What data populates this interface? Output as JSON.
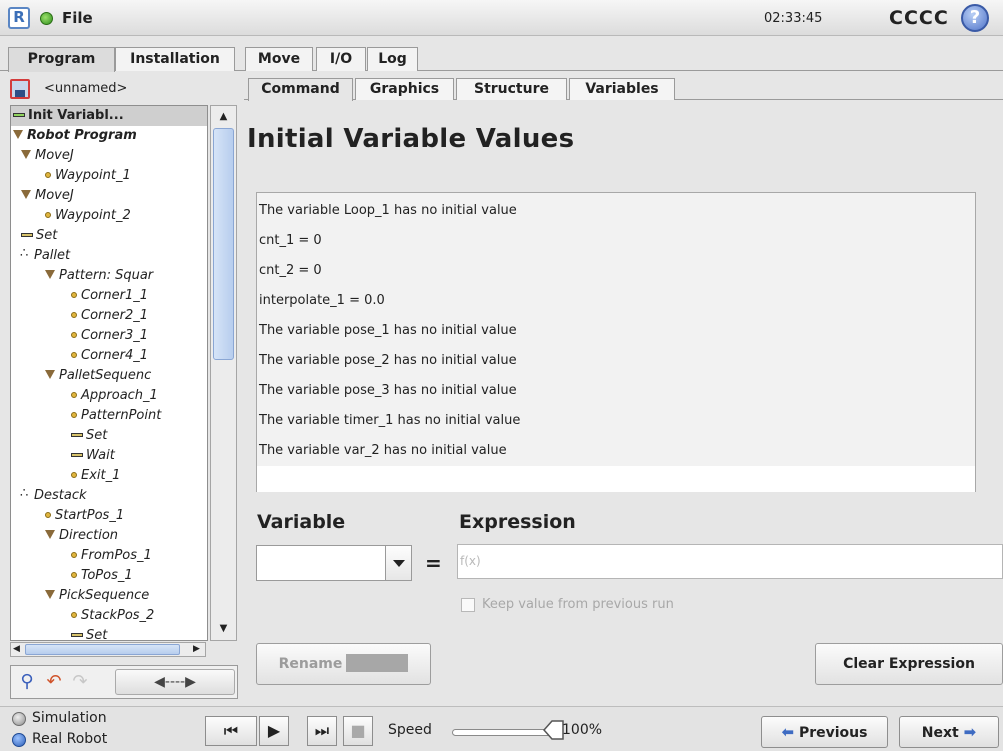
{
  "topbar": {
    "logo": "R",
    "file_label": "File",
    "clock": "02:33:45",
    "robot_name": "CCCC",
    "help": "?"
  },
  "main_tabs": [
    "Program",
    "Installation",
    "Move",
    "I/O",
    "Log"
  ],
  "program": {
    "name": "<unnamed>"
  },
  "tree": [
    {
      "label": "Init Variabl...",
      "level": 0,
      "icon": "bar-green",
      "bold": true,
      "selected": true,
      "italic": false
    },
    {
      "label": "Robot Program",
      "level": 0,
      "icon": "triangle",
      "bold": true,
      "italic": true
    },
    {
      "label": "MoveJ",
      "level": 1,
      "icon": "triangle",
      "italic": true
    },
    {
      "label": "Waypoint_1",
      "level": 2,
      "icon": "waypoint",
      "italic": true
    },
    {
      "label": "MoveJ",
      "level": 1,
      "icon": "triangle",
      "italic": true
    },
    {
      "label": "Waypoint_2",
      "level": 2,
      "icon": "waypoint",
      "italic": true
    },
    {
      "label": "Set",
      "level": 1,
      "icon": "bar",
      "italic": true
    },
    {
      "label": "Pallet",
      "level": 1,
      "icon": "pallet",
      "italic": true
    },
    {
      "label": "Pattern: Squar",
      "level": 2,
      "icon": "triangle",
      "italic": true
    },
    {
      "label": "Corner1_1",
      "level": 3,
      "icon": "waypoint",
      "italic": true
    },
    {
      "label": "Corner2_1",
      "level": 3,
      "icon": "waypoint",
      "italic": true
    },
    {
      "label": "Corner3_1",
      "level": 3,
      "icon": "waypoint",
      "italic": true
    },
    {
      "label": "Corner4_1",
      "level": 3,
      "icon": "waypoint",
      "italic": true
    },
    {
      "label": "PalletSequenc",
      "level": 2,
      "icon": "triangle",
      "italic": true
    },
    {
      "label": "Approach_1",
      "level": 3,
      "icon": "waypoint",
      "italic": true
    },
    {
      "label": "PatternPoint",
      "level": 3,
      "icon": "waypoint",
      "italic": true
    },
    {
      "label": "Set",
      "level": 3,
      "icon": "bar",
      "italic": true
    },
    {
      "label": "Wait",
      "level": 3,
      "icon": "bar",
      "italic": true
    },
    {
      "label": "Exit_1",
      "level": 3,
      "icon": "waypoint",
      "italic": true
    },
    {
      "label": "Destack",
      "level": 1,
      "icon": "pallet",
      "italic": true
    },
    {
      "label": "StartPos_1",
      "level": 2,
      "icon": "waypoint",
      "italic": true
    },
    {
      "label": "Direction",
      "level": 2,
      "icon": "triangle",
      "italic": true
    },
    {
      "label": "FromPos_1",
      "level": 3,
      "icon": "waypoint",
      "italic": true
    },
    {
      "label": "ToPos_1",
      "level": 3,
      "icon": "waypoint",
      "italic": true
    },
    {
      "label": "PickSequence",
      "level": 2,
      "icon": "triangle",
      "italic": true
    },
    {
      "label": "StackPos_2",
      "level": 3,
      "icon": "waypoint",
      "italic": true
    },
    {
      "label": "Set",
      "level": 3,
      "icon": "bar",
      "italic": true
    }
  ],
  "sub_tabs": [
    "Command",
    "Graphics",
    "Structure",
    "Variables"
  ],
  "page_title": "Initial Variable Values",
  "variables": [
    "The variable Loop_1 has no initial value",
    "cnt_1 = 0",
    "cnt_2 = 0",
    "interpolate_1 = 0.0",
    "The variable pose_1 has no initial value",
    "The variable pose_2 has no initial value",
    "The variable pose_3 has no initial value",
    "The variable timer_1 has no initial value",
    "The variable var_2 has no initial value"
  ],
  "form": {
    "variable_label": "Variable",
    "expression_label": "Expression",
    "equals": "=",
    "expression_placeholder": "f(x)",
    "keep_value_label": "Keep value from previous run",
    "rename_label": "Rename",
    "clear_label": "Clear Expression"
  },
  "bottombar": {
    "simulation_label": "Simulation",
    "real_robot_label": "Real Robot",
    "speed_label": "Speed",
    "speed_value": "100%",
    "speed_fraction": 1.0,
    "previous_label": "Previous",
    "next_label": "Next"
  },
  "colors": {
    "accent_blue": "#3e6bc2",
    "selection": "#cfcfcf",
    "active_green": "#2f8f1c"
  }
}
